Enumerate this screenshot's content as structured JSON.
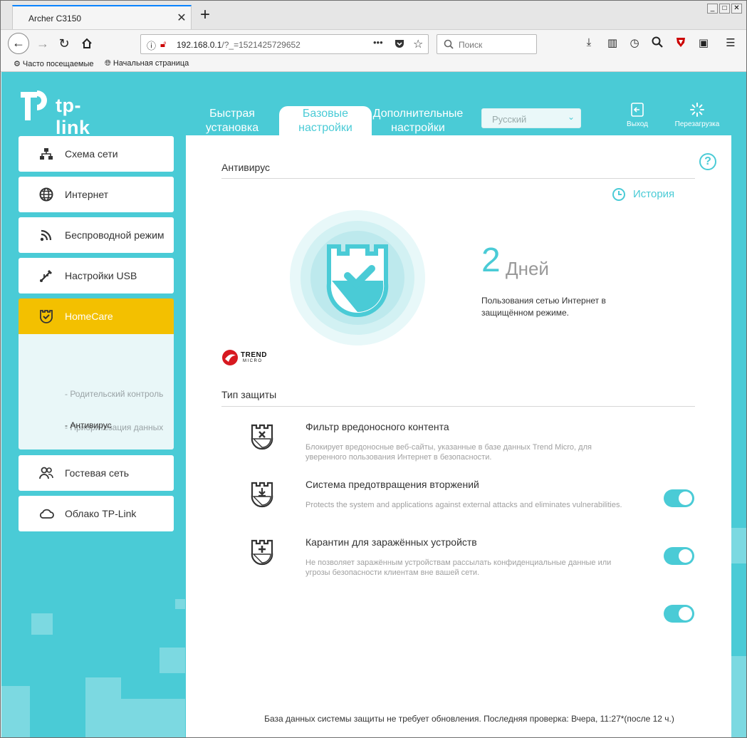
{
  "browser": {
    "tab_title": "Archer C3150",
    "tab_close": "✕",
    "new_tab": "+",
    "url_host": "192.168.0.1",
    "url_path": "/?_=1521425729652",
    "search_placeholder": "Поиск",
    "bookmarks": [
      "Часто посещаемые",
      "Начальная страница"
    ]
  },
  "router": {
    "brand": "tp-link",
    "topnav": [
      {
        "line1": "Быстрая",
        "line2": "установка"
      },
      {
        "line1": "Базовые",
        "line2": "настройки"
      },
      {
        "line1": "Дополнительные",
        "line2": "настройки"
      }
    ],
    "language": "Русский",
    "logout_label": "Выход",
    "reboot_label": "Перезагрузка",
    "sidebar": [
      "Схема сети",
      "Интернет",
      "Беспроводной режим",
      "Настройки USB",
      "HomeCare",
      "Гостевая сеть",
      "Облако TP-Link"
    ],
    "homecare_sub": [
      "- Родительский контроль",
      "- Приоритезация данных",
      "- Антивирус"
    ]
  },
  "antivirus": {
    "section_title": "Антивирус",
    "history_label": "История",
    "days_value": "2",
    "days_unit": "Дней",
    "days_desc": "Пользования сетью Интернет в защищённом режиме.",
    "trend_brand": "TREND",
    "trend_sub": "MICRO",
    "protection_title": "Тип защиты",
    "features": [
      {
        "title": "Фильтр вредоносного контента",
        "desc": "Блокирует вредоносные веб-сайты, указанные в базе данных Trend Micro, для уверенного пользования Интернет в безопасности.",
        "enabled": true
      },
      {
        "title": "Система предотвращения вторжений",
        "desc": "Protects the system and applications against external attacks and eliminates vulnerabilities.",
        "enabled": true
      },
      {
        "title": "Карантин для заражённых устройств",
        "desc": "Не позволяет заражённым устройствам рассылать конфиденциальные данные или угрозы безопасности клиентам вне вашей сети.",
        "enabled": true
      }
    ],
    "footer_note": "База данных системы защиты не требует обновления. Последняя проверка: Вчера, 11:27*(после 12 ч.)"
  },
  "colors": {
    "accent": "#4acbd6",
    "active_menu": "#f3c000"
  }
}
